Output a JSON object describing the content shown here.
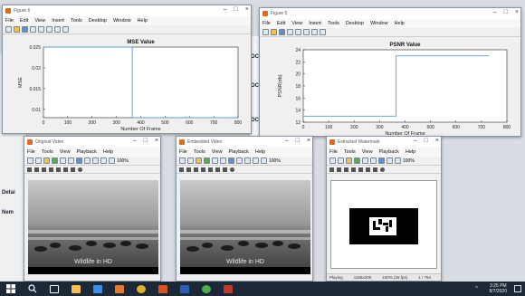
{
  "figure6": {
    "title": "Figure 6",
    "menu": [
      "File",
      "Edit",
      "View",
      "Insert",
      "Tools",
      "Desktop",
      "Window",
      "Help"
    ],
    "chart_data": {
      "type": "line",
      "title": "MSE Value",
      "xlabel": "Number Of Frame",
      "ylabel": "MSE",
      "xlim": [
        0,
        800
      ],
      "ylim": [
        0.008,
        0.025
      ],
      "x_ticks": [
        "0",
        "100",
        "200",
        "300",
        "400",
        "500",
        "600",
        "700",
        "800"
      ],
      "y_ticks": [
        "0.01",
        "0.015",
        "0.02",
        "0.025"
      ],
      "series": [
        {
          "x": [
            0,
            365,
            365,
            800
          ],
          "y": [
            0.025,
            0.025,
            0.008,
            0.008
          ]
        }
      ],
      "line_color": "#5b9bd5"
    }
  },
  "figure5": {
    "title": "Figure 5",
    "menu": [
      "File",
      "Edit",
      "View",
      "Insert",
      "Tools",
      "Desktop",
      "Window",
      "Help"
    ],
    "chart_data": {
      "type": "line",
      "title": "PSNR Value",
      "xlabel": "Number Of Frame",
      "ylabel": "PSNR(db)",
      "xlim": [
        0,
        800
      ],
      "ylim": [
        12,
        24
      ],
      "x_ticks": [
        "0",
        "100",
        "200",
        "300",
        "400",
        "500",
        "600",
        "700",
        "800"
      ],
      "y_ticks": [
        "12",
        "14",
        "16",
        "18",
        "20",
        "22",
        "24"
      ],
      "series": [
        {
          "x": [
            0,
            365,
            365,
            730
          ],
          "y": [
            13,
            13,
            23,
            23
          ]
        }
      ],
      "line_color": "#5b9bd5"
    }
  },
  "original_video": {
    "title": "Original Video",
    "menu": [
      "File",
      "Tools",
      "View",
      "Playback",
      "Help"
    ],
    "zoom": "100%",
    "caption": "Wildlife in HD"
  },
  "embedded_video": {
    "title": "Embedded Video",
    "menu": [
      "File",
      "Tools",
      "View",
      "Playback",
      "Help"
    ],
    "zoom": "100%",
    "caption": "Wildlife in HD"
  },
  "extracted_watermark": {
    "title": "Extracted Watermark",
    "menu": [
      "File",
      "Tools",
      "View",
      "Playback",
      "Help"
    ],
    "zoom": "100%",
    "status": [
      "Playing",
      "1168x200",
      "100% (25 fps)",
      "1 / 754"
    ]
  },
  "background": {
    "labels": [
      "OC",
      "OC",
      "OC",
      "Detai",
      "Nem"
    ]
  },
  "taskbar": {
    "time": "3:25 PM",
    "date": "8/7/2020"
  }
}
